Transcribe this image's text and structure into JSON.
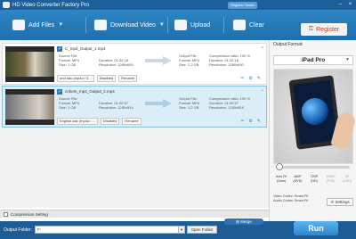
{
  "window": {
    "title": "HD Video Converter Factory Pro",
    "register_badge": "Register Studio"
  },
  "toolbar": {
    "add_files": "Add Files",
    "download_video": "Download Video",
    "upload": "Upload",
    "clear": "Clear",
    "register": "Register"
  },
  "files": [
    {
      "name": "C_mp4_Output_1.mp4",
      "source_label": "Source File:",
      "format": "Format: MP4",
      "duration": "Duration: 01:32:18",
      "size": "Size: 1 GB",
      "resolution": "Resolution: 1280x690",
      "output_label": "Output File:",
      "out_format": "Format: MP4",
      "out_size": "Size: 2.2 GB",
      "compression": "Compression ratio: 100 %",
      "out_duration": "Duration: 01:32:18",
      "out_resolution": "Resolution: 1280x690",
      "audio_track": "und aac (mp4a / 0...",
      "subtitle": "Disabled",
      "rename": "Rename"
    },
    {
      "name": "cnhem_mp4_Output_2.mp4",
      "source_label": "Source File:",
      "format": "Format: MP4",
      "duration": "Duration: 01:00:57",
      "size": "Size: 1 GB",
      "resolution": "Resolution: 1280x544",
      "output_label": "Output File:",
      "out_format": "Format: MP4",
      "out_size": "Size: 1.2 GB",
      "compression": "Compression ratio: 100 %",
      "out_duration": "Duration: 01:00:57",
      "out_resolution": "Resolution: 1280x544",
      "audio_track": "English aac (mp4a / ...",
      "subtitle": "Disabled",
      "rename": "Rename"
    }
  ],
  "compression_setting": "Compression Setting",
  "merge": "Merge",
  "output_folder": {
    "label": "Output Folder:",
    "value": "F:",
    "open_folder": "Open Folder"
  },
  "run": "Run",
  "right_panel": {
    "title": "Output Format:",
    "format": "iPad Pro",
    "quality_labels": [
      {
        "line1": "Auto Fit",
        "line2": "(Ours)"
      },
      {
        "line1": "480P",
        "line2": "(DVD)"
      },
      {
        "line1": "720P",
        "line2": "(HD)"
      },
      {
        "line1": "1080P",
        "line2": "(FHD)"
      },
      {
        "line1": "4K",
        "line2": "(UHD)"
      }
    ],
    "video_codec": "Video Codec: Smart Fit",
    "audio_codec": "Audio Codec: Smart Fit",
    "settings": "Settings",
    "quality_level": 0
  }
}
